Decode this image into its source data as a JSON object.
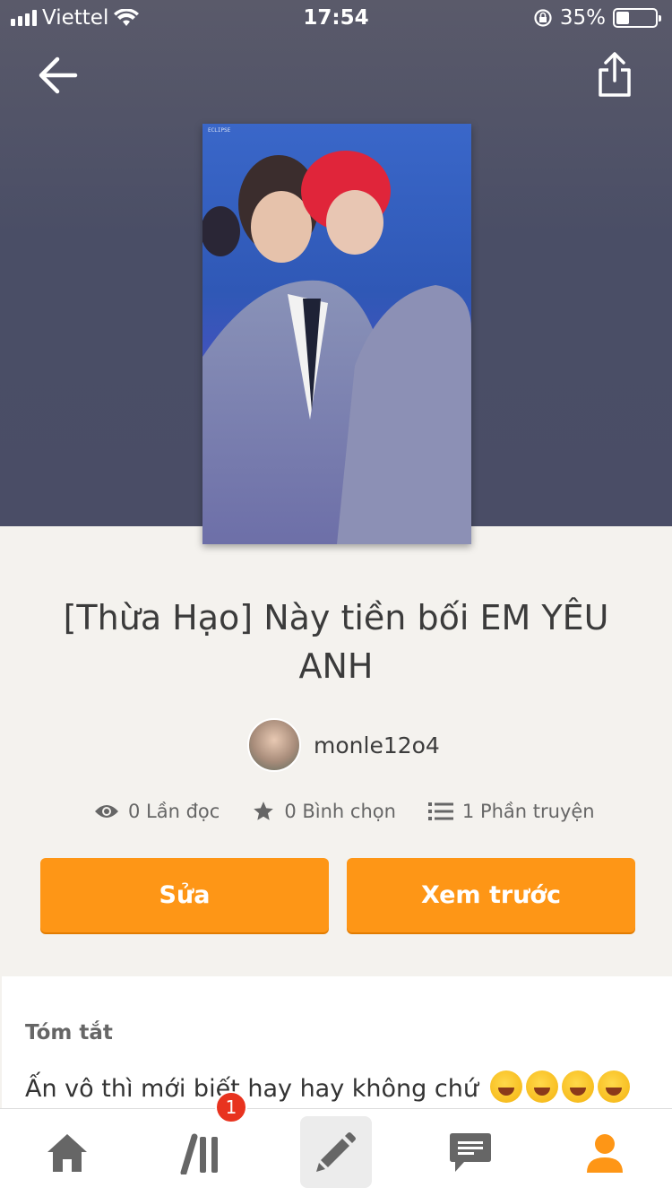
{
  "status_bar": {
    "carrier": "Viettel",
    "time": "17:54",
    "battery": "35%"
  },
  "story": {
    "title": "[Thừa Hạo] Này tiền bối EM YÊU ANH",
    "author": "monle12o4",
    "cover_caption": "ECLIPSE"
  },
  "stats": {
    "reads": "0 Lần đọc",
    "votes": "0 Bình chọn",
    "parts": "1 Phần truyện"
  },
  "buttons": {
    "edit": "Sửa",
    "preview": "Xem trước"
  },
  "summary": {
    "heading": "Tóm tắt",
    "text": "Ấn vô thì mới biết hay hay không chứ"
  },
  "tabbar": {
    "library_badge": "1"
  },
  "colors": {
    "accent": "#fe9616",
    "badge": "#e8331f"
  }
}
